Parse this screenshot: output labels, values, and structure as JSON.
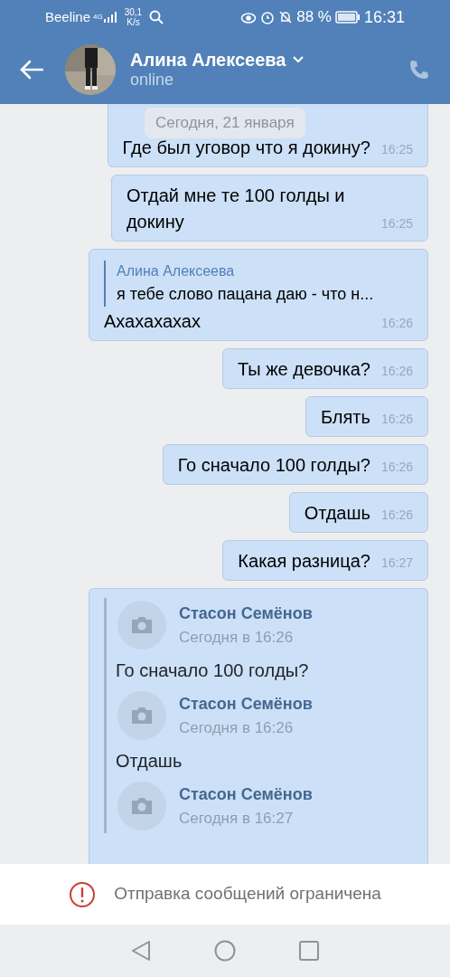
{
  "status_bar": {
    "carrier": "Beeline",
    "network": "4G",
    "speed": "30,1",
    "speed_unit": "K/s",
    "battery": "88 %",
    "time": "16:31"
  },
  "header": {
    "name": "Алина Алексеева",
    "status": "online"
  },
  "date_pill": "Сегодня, 21 января",
  "messages": [
    {
      "kind": "text",
      "text": "Где был уговор что я докину?",
      "time": "16:25"
    },
    {
      "kind": "text",
      "text": "Отдай мне те 100 голды и докину",
      "time": "16:25"
    },
    {
      "kind": "reply",
      "quote_author": "Алина Алексеева",
      "quote_text": "я тебе слово пацана даю - что н...",
      "text": "Ахахахахах",
      "time": "16:26"
    },
    {
      "kind": "text",
      "text": "Ты же девочка?",
      "time": "16:26"
    },
    {
      "kind": "text",
      "text": "Блять",
      "time": "16:26"
    },
    {
      "kind": "text",
      "text": "Го сначало 100 голды?",
      "time": "16:26"
    },
    {
      "kind": "text",
      "text": "Отдашь",
      "time": "16:26"
    },
    {
      "kind": "text",
      "text": "Какая разница?",
      "time": "16:27"
    },
    {
      "kind": "forward",
      "items": [
        {
          "author": "Стасон Семёнов",
          "time": "Сегодня в 16:26",
          "text": "Го сначало 100 голды?"
        },
        {
          "author": "Стасон Семёнов",
          "time": "Сегодня в 16:26",
          "text": "Отдашь"
        },
        {
          "author": "Стасон Семёнов",
          "time": "Сегодня в 16:27"
        }
      ]
    }
  ],
  "footer": {
    "notice": "Отправка сообщений ограничена"
  }
}
